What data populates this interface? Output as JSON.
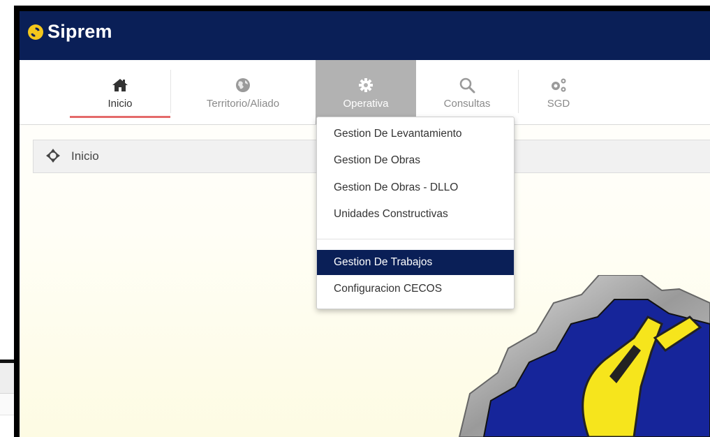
{
  "app": {
    "title": "Siprem"
  },
  "nav": {
    "tabs": [
      {
        "label": "Inicio",
        "icon": "home-icon"
      },
      {
        "label": "Territorio/Aliado",
        "icon": "globe-icon"
      },
      {
        "label": "Operativa",
        "icon": "gear-icon"
      },
      {
        "label": "Consultas",
        "icon": "search-icon"
      },
      {
        "label": "SGD",
        "icon": "gears-icon"
      }
    ],
    "active_tab": "Inicio",
    "open_menu": "Operativa"
  },
  "breadcrumb": {
    "icon": "crosshair-icon",
    "label": "Inicio"
  },
  "dropdown": {
    "items": [
      {
        "label": "Gestion De Levantamiento"
      },
      {
        "label": "Gestion De Obras"
      },
      {
        "label": "Gestion De Obras - DLLO"
      },
      {
        "label": "Unidades Constructivas"
      },
      {
        "label": "Gestion De Trabajos"
      },
      {
        "label": "Configuracion CECOS"
      }
    ],
    "highlighted": "Gestion De Trabajos"
  },
  "colors": {
    "header": "#0a1f57",
    "active_tab_underline": "#e46a6a",
    "open_tab_bg": "#b2b2b2",
    "highlight": "#0a1f57",
    "logo_yellow": "#f6e51c"
  }
}
